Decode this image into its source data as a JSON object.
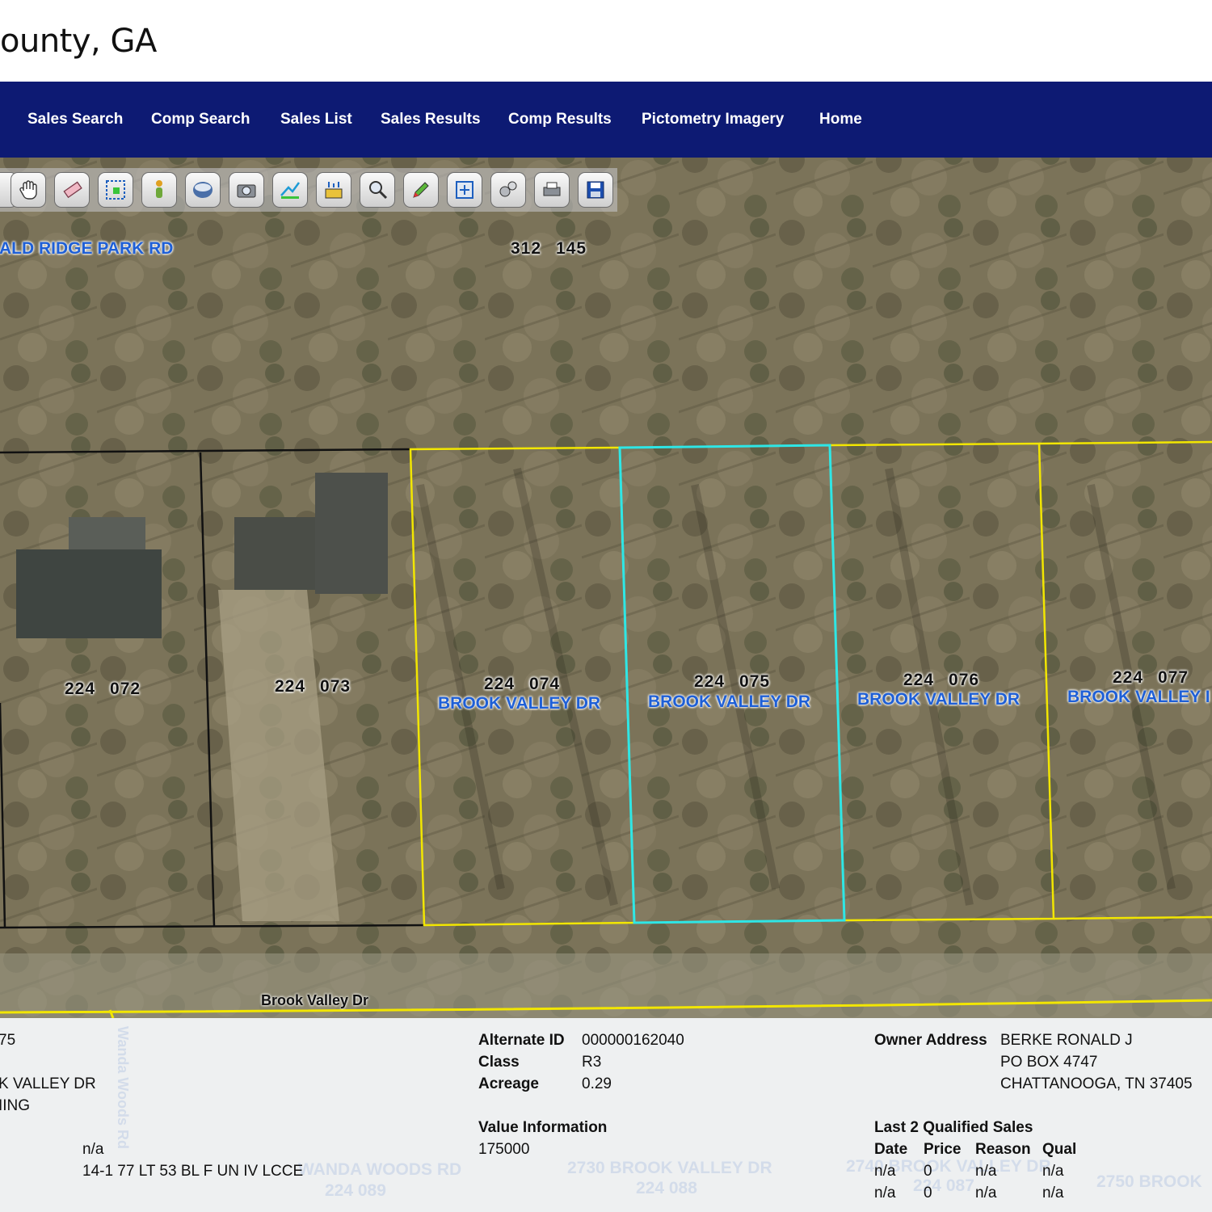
{
  "header": {
    "title": "ounty, GA"
  },
  "nav": [
    {
      "label": "Sales Search"
    },
    {
      "label": "Comp Search"
    },
    {
      "label": "Sales List"
    },
    {
      "label": "Sales Results"
    },
    {
      "label": "Comp Results"
    },
    {
      "label": "Pictometry Imagery"
    },
    {
      "label": "Home"
    }
  ],
  "toolbar": [
    {
      "icon": "pan-hand-icon"
    },
    {
      "icon": "eraser-icon"
    },
    {
      "icon": "select-parcel-icon"
    },
    {
      "icon": "identify-person-icon"
    },
    {
      "icon": "layers-icon"
    },
    {
      "icon": "camera-icon"
    },
    {
      "icon": "measure-icon"
    },
    {
      "icon": "buffer-icon"
    },
    {
      "icon": "zoom-magnifier-icon"
    },
    {
      "icon": "draw-pencil-icon"
    },
    {
      "icon": "full-extent-icon"
    },
    {
      "icon": "settings-gears-icon"
    },
    {
      "icon": "print-icon"
    },
    {
      "icon": "save-icon"
    }
  ],
  "colors": {
    "nav_bg": "#0d1a73",
    "selected_parcel": "#2ee6e6",
    "highlight_parcel": "#f2e600",
    "parcel_line": "#111111",
    "street_label": "#1e5fd6"
  },
  "map": {
    "street_top": "ALD RIDGE PARK RD",
    "road_label": "Brook Valley Dr",
    "side_road": "Wanda Woods Rd",
    "parcels": [
      {
        "map": "312",
        "num": "145",
        "street": ""
      },
      {
        "map": "224",
        "num": "072",
        "street": ""
      },
      {
        "map": "224",
        "num": "073",
        "street": ""
      },
      {
        "map": "224",
        "num": "074",
        "street": "BROOK VALLEY DR"
      },
      {
        "map": "224",
        "num": "075",
        "street": "BROOK VALLEY DR"
      },
      {
        "map": "224",
        "num": "076",
        "street": "BROOK VALLEY DR"
      },
      {
        "map": "224",
        "num": "077",
        "street": "BROOK VALLEY I"
      }
    ]
  },
  "info": {
    "left": {
      "line1": "75",
      "line2": "K VALLEY DR",
      "line3": "IING",
      "line4_value": "n/a",
      "line5_value": "14-1 77 LT 53 BL F UN IV LCCE"
    },
    "mid": {
      "alt_id_label": "Alternate ID",
      "alt_id": "000000162040",
      "class_label": "Class",
      "class": "R3",
      "acreage_label": "Acreage",
      "acreage": "0.29",
      "value_heading": "Value Information",
      "value": "175000"
    },
    "right": {
      "owner_label": "Owner Address",
      "owner_name": "BERKE RONALD J",
      "owner_addr1": "PO BOX 4747",
      "owner_addr2": "CHATTANOOGA, TN 37405",
      "sales_heading": "Last 2 Qualified Sales",
      "columns": [
        "Date",
        "Price",
        "Reason",
        "Qual"
      ],
      "rows": [
        [
          "n/a",
          "0",
          "n/a",
          "n/a"
        ],
        [
          "n/a",
          "0",
          "n/a",
          "n/a"
        ]
      ]
    },
    "ghost_labels": {
      "g1": "WANDA WOODS RD",
      "g2": "224 089",
      "g3": "2730 BROOK VALLEY DR",
      "g4": "224 088",
      "g5": "2740 BROOK VALLEY DR",
      "g6": "224 087",
      "g7": "2750 BROOK"
    }
  }
}
